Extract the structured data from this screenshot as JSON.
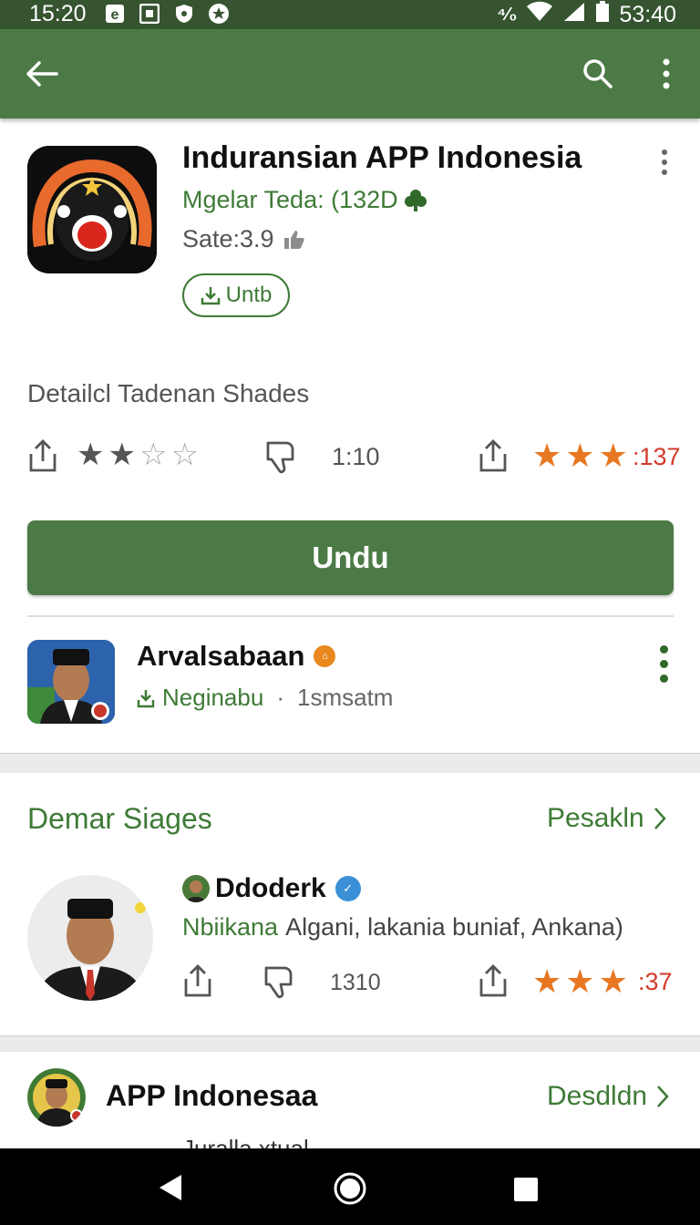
{
  "status_bar": {
    "time": "15:20",
    "battery_text": "53:40",
    "network_text": "⁴⁄₀"
  },
  "app": {
    "title": "Induransian APP Indonesia",
    "developer": "Mgelar Teda: (132D",
    "size": "Sate:3.9",
    "install_chip": "Untb",
    "details_label": "Detailcl Tadenan Shades",
    "rating_left_count": "1:10",
    "rating_right_count": ":137",
    "rating_left_stars": 2,
    "rating_right_stars": 3,
    "main_button": "Undu"
  },
  "review_top": {
    "name": "Arvalsabaan",
    "sub_link": "Neginabu",
    "sub_dot": "·",
    "sub_meta": "1smsatm"
  },
  "section_similar": {
    "title": "Demar Siages",
    "link": "Pesakln",
    "item": {
      "name": "Ddoderk",
      "desc_green": "Nbiikana",
      "desc_rest": "Algani, lakania buniaf, Ankana)",
      "count": "1310",
      "rating": ":37",
      "stars": 3
    }
  },
  "section_bottom": {
    "title": "APP Indonesaa",
    "link": "Desdldn",
    "partial_text": "Juralla xtual"
  },
  "colors": {
    "status_bar": "#35542f",
    "app_bar": "#4c7a46",
    "accent_green": "#3e7a36",
    "star_orange": "#e87722",
    "rating_red": "#d23a2b"
  }
}
